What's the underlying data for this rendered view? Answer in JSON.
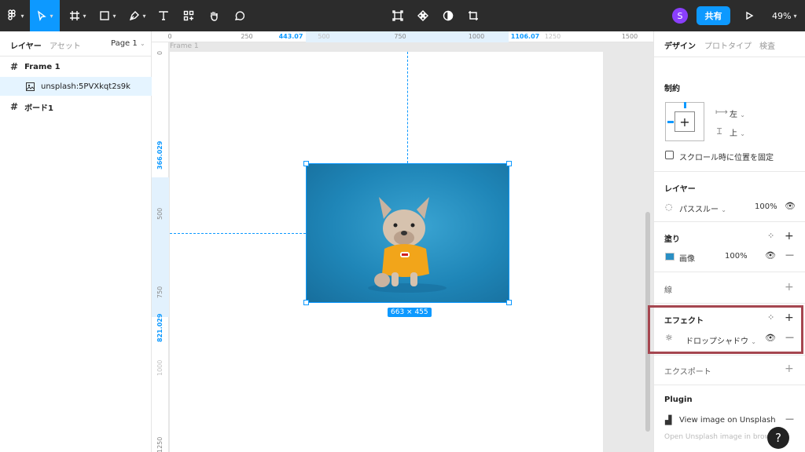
{
  "toolbar": {
    "share_label": "共有",
    "avatar_initial": "S",
    "zoom_label": "49%"
  },
  "left_panel": {
    "tab_layers": "レイヤー",
    "tab_assets": "アセット",
    "page_label": "Page 1",
    "layers": [
      {
        "label": "Frame 1"
      },
      {
        "label": "unsplash:5PVXkqt2s9k"
      },
      {
        "label": "ボード1"
      }
    ]
  },
  "canvas": {
    "frame_label": "Frame 1",
    "ruler_top": [
      "0",
      "250",
      "443.07",
      "500",
      "750",
      "1000",
      "1106.07",
      "1250",
      "1500"
    ],
    "ruler_left": [
      "0",
      "366.029",
      "500",
      "750",
      "821.029",
      "1000",
      "1250"
    ],
    "size_badge": "663 × 455"
  },
  "right_panel": {
    "tabs": [
      "デザイン",
      "プロトタイプ",
      "検査"
    ],
    "constraints_title": "制約",
    "constraint_h": "左",
    "constraint_v": "上",
    "fix_position_label": "スクロール時に位置を固定",
    "layer_title": "レイヤー",
    "blend_mode": "パススルー",
    "layer_opacity": "100%",
    "fill_title": "塗り",
    "fill_type": "画像",
    "fill_opacity": "100%",
    "stroke_title": "線",
    "effects_title": "エフェクト",
    "effect_type": "ドロップシャドウ",
    "export_title": "エクスポート",
    "plugin_title": "Plugin",
    "plugin_item": "View image on Unsplash",
    "plugin_item2": "Open Unsplash image in browse"
  },
  "colors": {
    "toolbar_bg": "#2c2c2c",
    "accent": "#0d99ff",
    "annotation": "#a54650",
    "avatar": "#8a3ffc"
  }
}
